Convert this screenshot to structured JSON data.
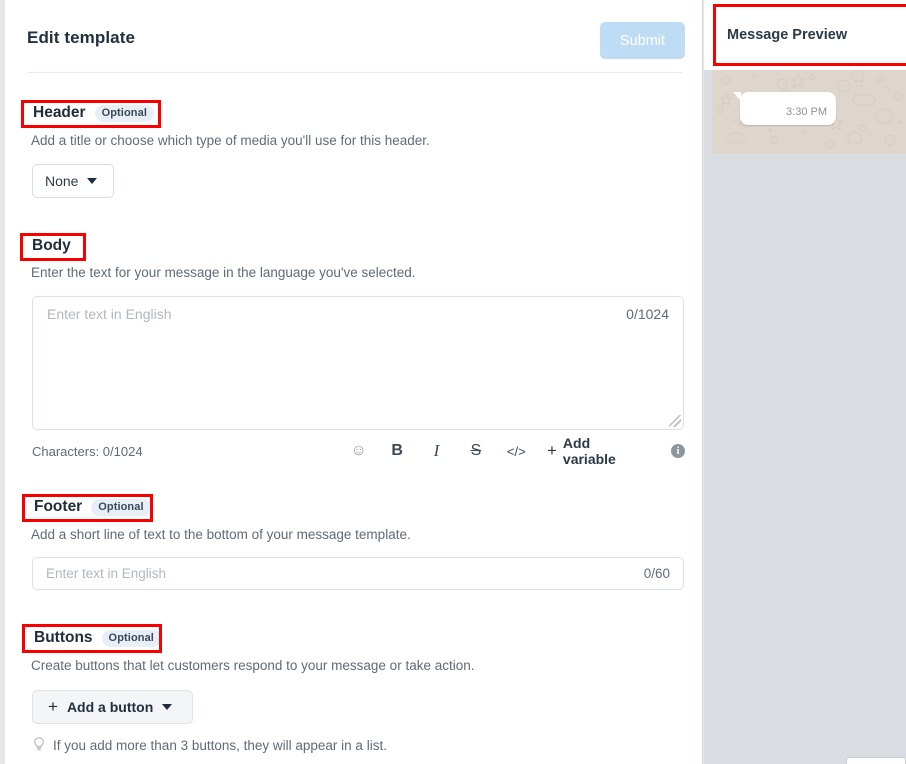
{
  "header_bar": {
    "title": "Edit template",
    "submit_label": "Submit"
  },
  "sections": {
    "header": {
      "title": "Header",
      "badge": "Optional",
      "description": "Add a title or choose which type of media you'll use for this header.",
      "select_value": "None"
    },
    "body": {
      "title": "Body",
      "description": "Enter the text for your message in the language you've selected.",
      "placeholder": "Enter text in English",
      "counter": "0/1024",
      "char_count_label": "Characters: 0/1024",
      "toolbar": {
        "emoji": "☺",
        "bold": "B",
        "italic": "I",
        "strike": "S",
        "code": "</>",
        "add_variable_plus": "+",
        "add_variable_label": "Add variable",
        "info": "i"
      }
    },
    "footer": {
      "title": "Footer",
      "badge": "Optional",
      "description": "Add a short line of text to the bottom of your message template.",
      "placeholder": "Enter text in English",
      "counter": "0/60"
    },
    "buttons": {
      "title": "Buttons",
      "badge": "Optional",
      "description": "Create buttons that let customers respond to your message or take action.",
      "add_button_plus": "+",
      "add_button_label": "Add a button",
      "hint": "If you add more than 3 buttons, they will appear in a list.",
      "hint_icon": "Ὂ1"
    }
  },
  "preview": {
    "title": "Message Preview",
    "bubble_time": "3:30 PM"
  },
  "colors": {
    "submit_disabled": "#bfdcf5",
    "badge_bg": "#e8eef6",
    "annotation_red": "#f80000",
    "chat_bg": "#ded6cd",
    "panel_bg": "#d9dde2"
  }
}
